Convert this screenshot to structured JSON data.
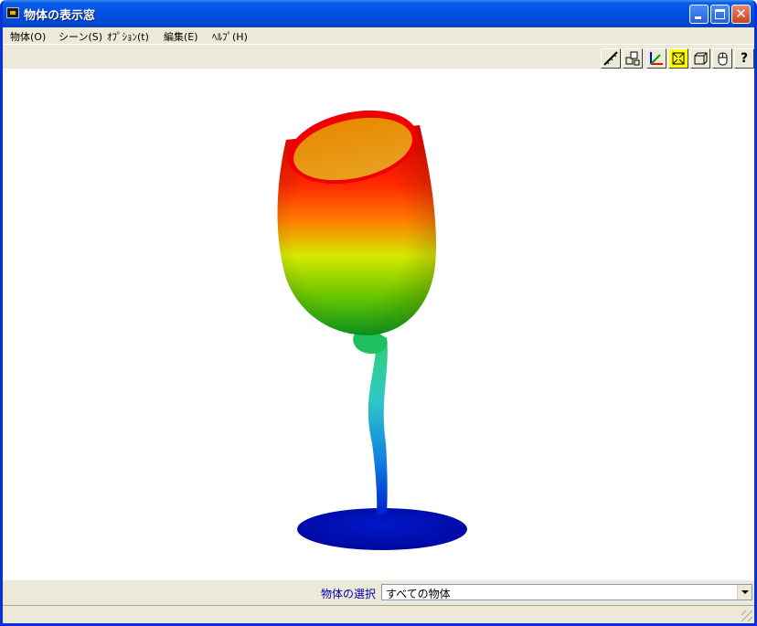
{
  "window": {
    "title": "物体の表示窓",
    "close_glyph": "✕"
  },
  "menu": [
    {
      "label": "物体(O)"
    },
    {
      "label": "シーン(S)"
    },
    {
      "label": "ｵﾌﾟｼｮﾝ(t)"
    },
    {
      "label": "編集(E)"
    },
    {
      "label": "ﾍﾙﾌﾟ(H)"
    }
  ],
  "toolbar": {
    "buttons": [
      {
        "icon": "measure-icon"
      },
      {
        "icon": "select-objects-icon"
      },
      {
        "icon": "axis-icon"
      },
      {
        "icon": "fit-view-icon",
        "active": true
      },
      {
        "icon": "box-view-icon"
      },
      {
        "icon": "mouse-icon"
      },
      {
        "icon": "help-icon",
        "text": "?"
      }
    ]
  },
  "viewport": {
    "object": "wine-glass",
    "colors": {
      "top": "#FF0000",
      "upper_middle": "#FF8000",
      "middle": "#D7E800",
      "lower": "#22B000",
      "stem": "#30D0B0",
      "base": "#0010B8"
    }
  },
  "object_select": {
    "label": "物体の選択",
    "value": "すべての物体"
  },
  "colors": {
    "titlebar": "#0054E3",
    "chrome": "#ECE9D8",
    "label_blue": "#0000AA",
    "active_tool": "#FFFF00"
  }
}
